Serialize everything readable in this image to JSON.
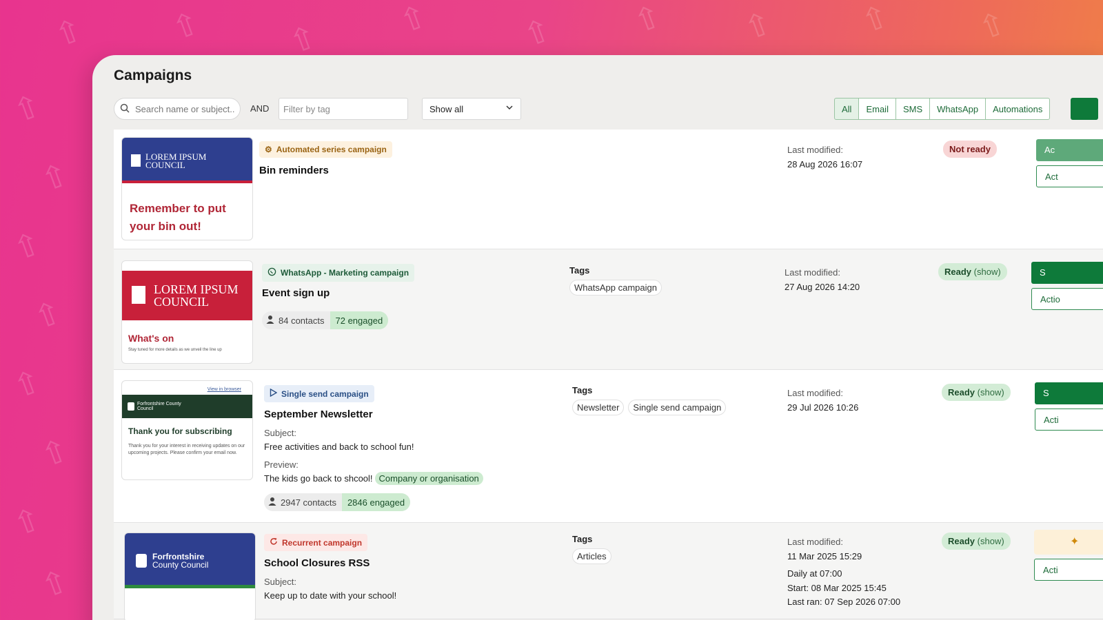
{
  "page": {
    "title": "Campaigns"
  },
  "toolbar": {
    "search_placeholder": "Search name or subject..",
    "and_label": "AND",
    "tag_filter_placeholder": "Filter by tag",
    "show_select": "Show all",
    "filters": [
      "All",
      "Email",
      "SMS",
      "WhatsApp",
      "Automations"
    ]
  },
  "campaigns": [
    {
      "type_label": "Automated series campaign",
      "name": "Bin reminders",
      "thumb_brand": "LOREM IPSUM COUNCIL",
      "thumb_text": "Remember to put your bin out!",
      "modified_label": "Last modified:",
      "modified": "28 Aug 2026 16:07",
      "status": "Not ready",
      "btn_primary": "Ac",
      "btn_secondary": "Act"
    },
    {
      "type_label": "WhatsApp - Marketing campaign",
      "name": "Event sign up",
      "thumb_brand": "LOREM IPSUM COUNCIL",
      "thumb_heading": "What's on",
      "thumb_small": "Stay tuned for more details as we unveil the line up",
      "contacts": "84 contacts",
      "engaged": "72 engaged",
      "tags_label": "Tags",
      "tags": [
        "WhatsApp campaign"
      ],
      "modified_label": "Last modified:",
      "modified": "27 Aug 2026 14:20",
      "status": "Ready",
      "status_show": "(show)",
      "btn_primary": "S",
      "btn_secondary": "Actio"
    },
    {
      "type_label": "Single send campaign",
      "name": "September Newsletter",
      "thumb_link": "View in browser",
      "thumb_brand": "Forfrontshire County Council",
      "thumb_heading": "Thank you for subscribing",
      "thumb_small": "Thank you for your interest in receiving updates on our upcoming projects. Please confirm your email now.",
      "subject_label": "Subject:",
      "subject": "Free activities and back to school fun!",
      "preview_label": "Preview:",
      "preview": "The kids go back to shcool!",
      "preview_tag": "Company or organisation",
      "contacts": "2947 contacts",
      "engaged": "2846 engaged",
      "tags_label": "Tags",
      "tags": [
        "Newsletter",
        "Single send campaign"
      ],
      "modified_label": "Last modified:",
      "modified": "29 Jul 2026 10:26",
      "status": "Ready",
      "status_show": "(show)",
      "btn_primary": "S",
      "btn_secondary": "Acti"
    },
    {
      "type_label": "Recurrent campaign",
      "name": "School Closures RSS",
      "thumb_brand_1": "Forfrontshire",
      "thumb_brand_2": "County Council",
      "subject_label": "Subject:",
      "subject": "Keep up to date with your school!",
      "tags_label": "Tags",
      "tags": [
        "Articles"
      ],
      "modified_label": "Last modified:",
      "modified": "11 Mar 2025 15:29",
      "schedule": "Daily at 07:00",
      "start": "Start: 08 Mar 2025 15:45",
      "last_ran": "Last ran: 07 Sep 2026 07:00",
      "status": "Ready",
      "status_show": "(show)",
      "btn_secondary": "Acti"
    }
  ],
  "colors": {
    "primary_green": "#0e7a3a",
    "brand_blue": "#2e3f8f",
    "brand_red": "#c8203a",
    "brand_dark_green": "#1f3d2a"
  },
  "icons": {
    "search": "search-icon",
    "chevron": "chevron-down-icon",
    "automation": "gear-icon",
    "whatsapp": "whatsapp-icon",
    "single": "play-icon",
    "recurrent": "refresh-icon",
    "contacts": "person-icon",
    "warning": "sparkle-icon"
  }
}
